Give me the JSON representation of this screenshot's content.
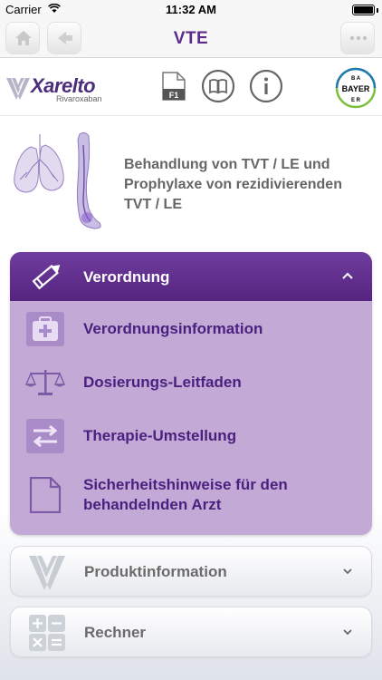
{
  "status_bar": {
    "carrier": "Carrier",
    "time": "11:32 AM"
  },
  "nav": {
    "title": "VTE"
  },
  "brand": {
    "product_name": "Xarelto",
    "product_sub": "Rivaroxaban",
    "f1_label": "F1",
    "bayer": "BAYER"
  },
  "hero": {
    "title_lines": [
      "Behandlung von TVT / LE und",
      "Prophylaxe von rezidivierenden",
      "TVT / LE"
    ]
  },
  "sections": {
    "verordnung": {
      "label": "Verordnung",
      "items": [
        {
          "label": "Verordnungsinformation",
          "icon": "first-aid-case-icon"
        },
        {
          "label": "Dosierungs-Leitfaden",
          "icon": "scale-icon"
        },
        {
          "label": "Therapie-Umstellung",
          "icon": "switch-arrows-icon"
        },
        {
          "label_lines": [
            "Sicherheitshinweise für den",
            "behandelnden Arzt"
          ],
          "icon": "document-icon"
        }
      ]
    },
    "produktinformation": {
      "label": "Produktinformation",
      "icon": "xarelto-mark-icon"
    },
    "rechner": {
      "label": "Rechner",
      "icon": "calculator-icon"
    }
  },
  "colors": {
    "accent": "#5a2b8a",
    "panel": "#c3a9d6",
    "header": "#6f3d9e"
  }
}
